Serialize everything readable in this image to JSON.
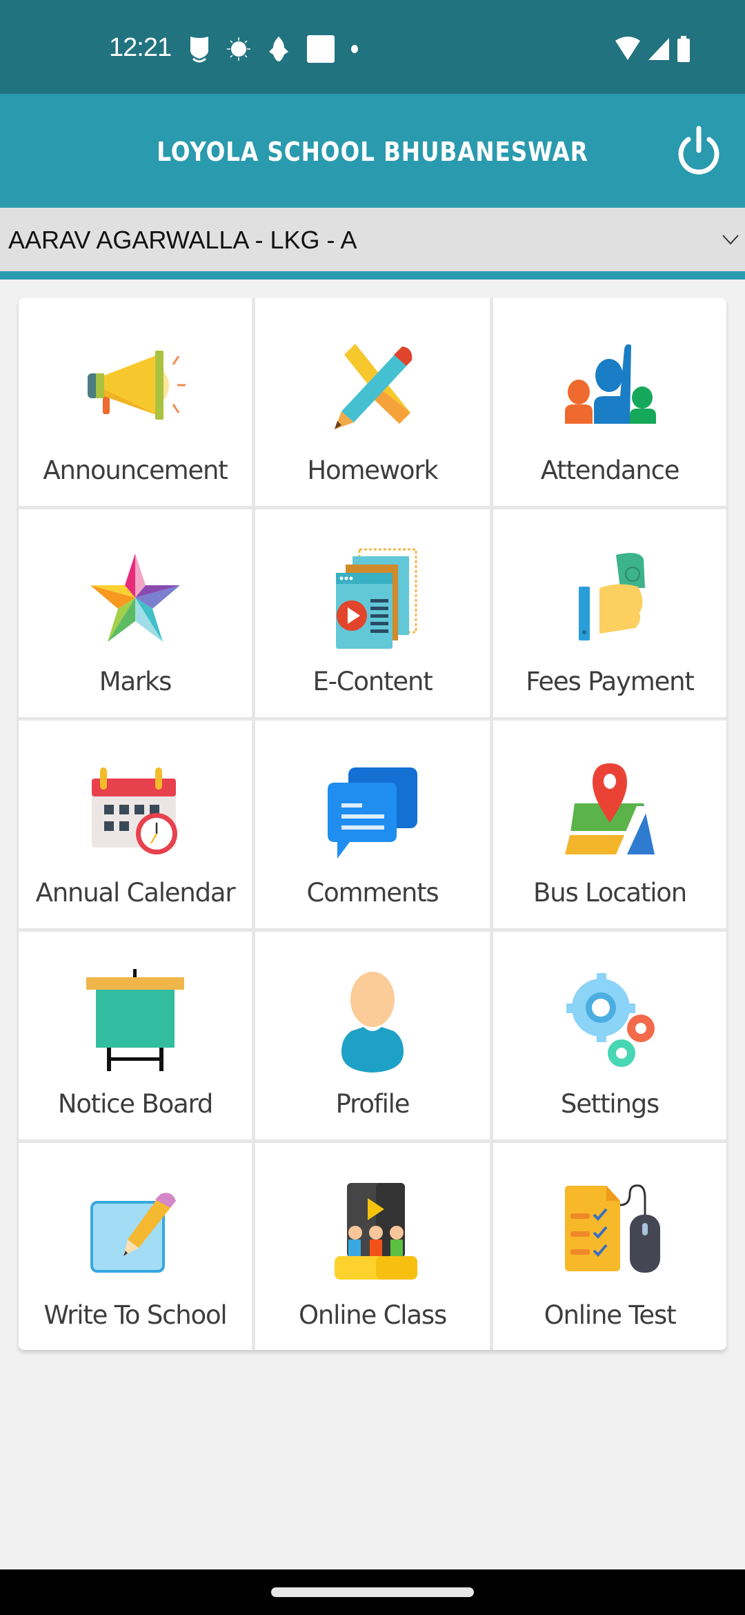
{
  "status_bar": {
    "time": "12:21",
    "left_icons": [
      "shield-notification-icon",
      "sun-notification-icon",
      "app-notification-icon",
      "square-notification-icon",
      "dot-notification-icon"
    ],
    "right_icons": [
      "wifi-icon",
      "signal-icon",
      "battery-icon"
    ]
  },
  "app_bar": {
    "title": "LOYOLA SCHOOL BHUBANESWAR",
    "power_icon": "power-icon"
  },
  "student_selector": {
    "selected": "AARAV AGARWALLA - LKG - A",
    "chevron_icon": "chevron-down-icon"
  },
  "menu": {
    "items": [
      {
        "label": "Announcement",
        "icon": "megaphone-icon"
      },
      {
        "label": "Homework",
        "icon": "pencil-ruler-icon"
      },
      {
        "label": "Attendance",
        "icon": "raised-hand-people-icon"
      },
      {
        "label": "Marks",
        "icon": "star-icon"
      },
      {
        "label": "E-Content",
        "icon": "video-document-icon"
      },
      {
        "label": "Fees Payment",
        "icon": "hand-money-icon"
      },
      {
        "label": "Annual Calendar",
        "icon": "calendar-clock-icon"
      },
      {
        "label": "Comments",
        "icon": "chat-bubbles-icon"
      },
      {
        "label": "Bus Location",
        "icon": "map-pin-icon"
      },
      {
        "label": "Notice Board",
        "icon": "easel-board-icon"
      },
      {
        "label": "Profile",
        "icon": "user-icon"
      },
      {
        "label": "Settings",
        "icon": "gears-icon"
      },
      {
        "label": "Write To School",
        "icon": "write-note-icon"
      },
      {
        "label": "Online Class",
        "icon": "video-class-icon"
      },
      {
        "label": "Online Test",
        "icon": "test-mouse-icon"
      }
    ]
  },
  "colors": {
    "status_bar": "#227380",
    "app_bar": "#2a9aae",
    "selector_bg": "#e0e0e0",
    "page_bg": "#f1f1f1"
  }
}
